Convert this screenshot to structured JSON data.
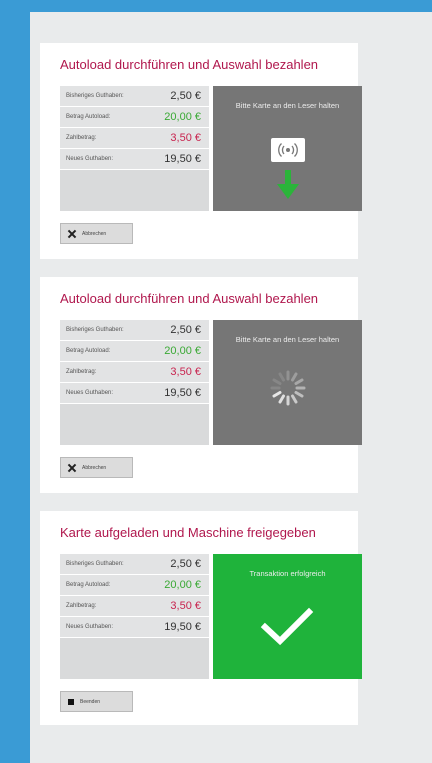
{
  "colors": {
    "background": "#3a9bd5",
    "title": "#b0174d",
    "autoload": "#3aa935",
    "zahlbetrag": "#c8244f",
    "success": "#1fb33b",
    "panel": "#767676"
  },
  "cards": [
    {
      "title": "Autoload durchführen und Auswahl bezahlen",
      "rows": [
        {
          "label": "Bisheriges Guthaben:",
          "value": "2,50 €"
        },
        {
          "label": "Betrag Autoload:",
          "value": "20,00 €"
        },
        {
          "label": "Zahlbetrag:",
          "value": "3,50 €"
        },
        {
          "label": "Neues Guthaben:",
          "value": "19,50 €"
        }
      ],
      "panel_text": "Bitte Karte an den Leser halten",
      "panel_icons": [
        "nfc-card-icon",
        "arrow-down-icon"
      ],
      "button": {
        "label": "Abbrechen",
        "icon": "close-icon"
      }
    },
    {
      "title": "Autoload durchführen und Auswahl bezahlen",
      "rows": [
        {
          "label": "Bisheriges Guthaben:",
          "value": "2,50 €"
        },
        {
          "label": "Betrag Autoload:",
          "value": "20,00 €"
        },
        {
          "label": "Zahlbetrag:",
          "value": "3,50 €"
        },
        {
          "label": "Neues Guthaben:",
          "value": "19,50 €"
        }
      ],
      "panel_text": "Bitte Karte an den Leser halten",
      "panel_icons": [
        "loading-spinner-icon"
      ],
      "button": {
        "label": "Abbrechen",
        "icon": "close-icon"
      }
    },
    {
      "title": "Karte aufgeladen und Maschine freigegeben",
      "rows": [
        {
          "label": "Bisheriges Guthaben:",
          "value": "2,50 €"
        },
        {
          "label": "Betrag Autoload:",
          "value": "20,00 €"
        },
        {
          "label": "Zahlbetrag:",
          "value": "3,50 €"
        },
        {
          "label": "Neues Guthaben:",
          "value": "19,50 €"
        }
      ],
      "panel_text": "Transaktion erfolgreich",
      "panel_icons": [
        "checkmark-icon"
      ],
      "button": {
        "label": "Beenden",
        "icon": "stop-icon"
      }
    }
  ]
}
